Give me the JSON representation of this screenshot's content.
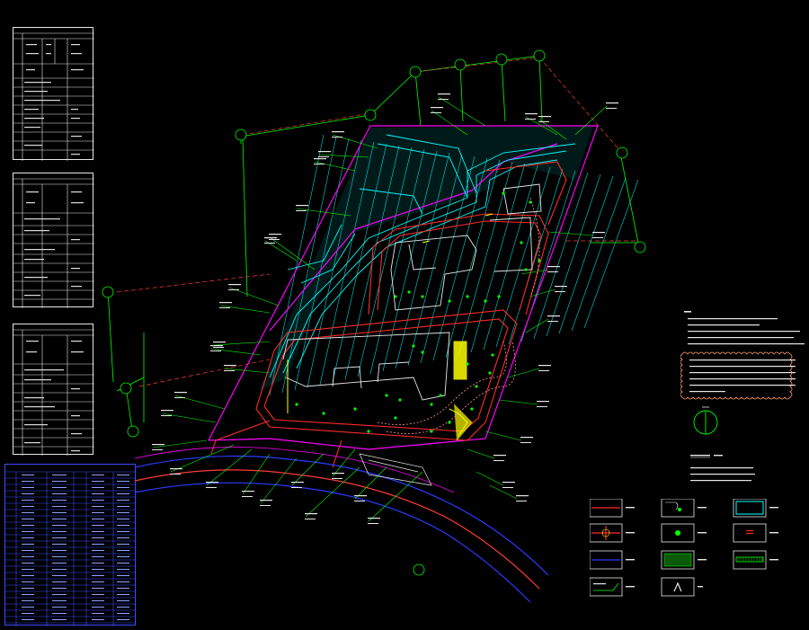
{
  "colors": {
    "background": "#000000",
    "boundary": "#ff3b3b",
    "road": "#ff0000",
    "green": "#00ff00",
    "cyan": "#00ffff",
    "magenta": "#ff00ff",
    "yellow": "#ffff00",
    "blue": "#2a3bff",
    "white": "#e8e8e8"
  },
  "drawing": {
    "north_symbol": "north-arrow-icon"
  },
  "legend": {
    "symbols": [
      "red-line-symbol",
      "tree-symbol",
      "cyan-rect-symbol",
      "road-cross-symbol",
      "shrub-symbol",
      "red-mark-symbol",
      "blue-line-symbol",
      "green-hatch-symbol",
      "fence-symbol",
      "green-arrow-symbol",
      "caret-symbol"
    ]
  }
}
